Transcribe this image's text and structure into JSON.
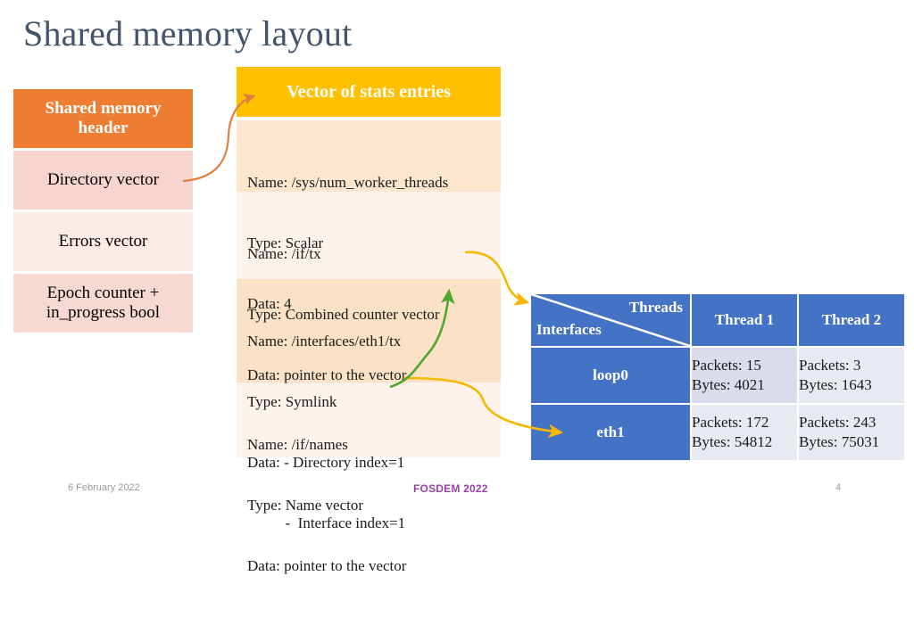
{
  "slide": {
    "title": "Shared memory layout"
  },
  "shared_memory_header": {
    "title": "Shared memory header",
    "rows": [
      {
        "label": "Directory vector"
      },
      {
        "label": "Errors vector"
      },
      {
        "label": "Epoch counter + in_progress bool"
      }
    ]
  },
  "stats_vector": {
    "title": "Vector of stats entries",
    "entries": [
      {
        "name": "Name: /sys/num_worker_threads",
        "type": "Type: Scalar",
        "data": "Data: 4"
      },
      {
        "name": "Name: /if/tx",
        "type": "Type: Combined counter vector",
        "data": "Data: pointer to the vector"
      },
      {
        "name": "Name: /interfaces/eth1/tx",
        "type": "Type: Symlink",
        "data": "Data: - Directory index=1",
        "data2": "          -  Interface index=1"
      },
      {
        "name": "Name: /if/names",
        "type": "Type: Name vector",
        "data": "Data: pointer to the vector"
      }
    ]
  },
  "counters_table": {
    "corner": {
      "columns_label": "Threads",
      "rows_label": "Interfaces"
    },
    "columns": [
      "Thread 1",
      "Thread 2"
    ],
    "rows": [
      {
        "interface": "loop0",
        "cells": [
          {
            "packets": "Packets: 15",
            "bytes": "Bytes: 4021"
          },
          {
            "packets": "Packets: 3",
            "bytes": "Bytes: 1643"
          }
        ]
      },
      {
        "interface": "eth1",
        "cells": [
          {
            "packets": "Packets: 172",
            "bytes": "Bytes: 54812"
          },
          {
            "packets": "Packets: 243",
            "bytes": "Bytes: 75031"
          }
        ]
      }
    ]
  },
  "footer": {
    "date": "6 February 2022",
    "event": "FOSDEM 2022",
    "page": "4"
  },
  "colors": {
    "title": "#44546a",
    "header_orange": "#ed7d31",
    "tint_pink_dark": "#f6d5ce",
    "tint_pink_light": "#fbebe7",
    "vector_header_yellow": "#ffc000",
    "entry_tan": "#fce6cd",
    "entry_cream": "#fdf3ec",
    "table_blue": "#4472c4",
    "cell_lavender": "#d9dcea",
    "arrow_orange": "#e07b39",
    "arrow_yellow": "#f5b800",
    "arrow_green": "#4ea72e",
    "event_purple": "#9b3fa8"
  }
}
